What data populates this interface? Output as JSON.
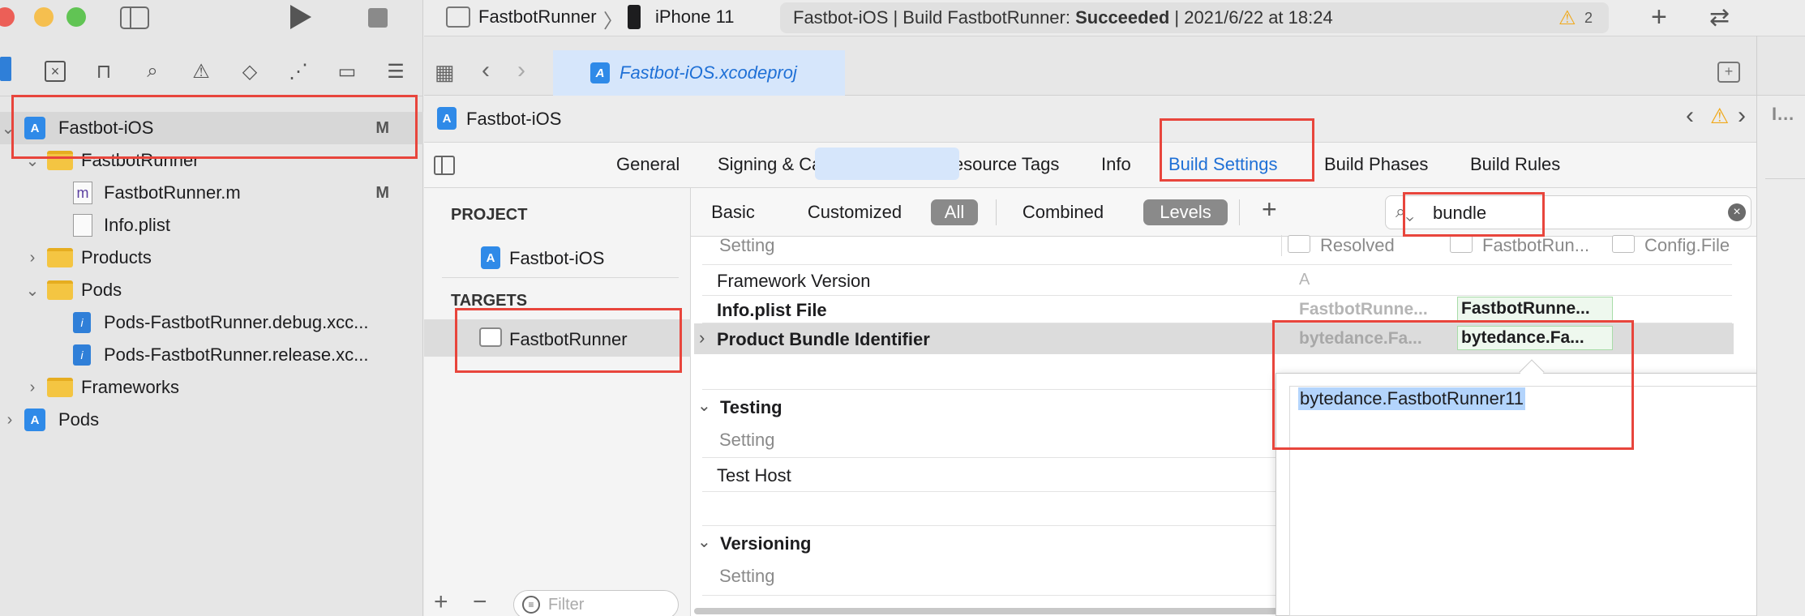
{
  "toolbar": {
    "scheme": "FastbotRunner",
    "device": "iPhone 11",
    "status_prefix": "Fastbot-iOS | Build FastbotRunner: ",
    "status_result": "Succeeded",
    "status_time": " | 2021/6/22 at 18:24",
    "warning_count": "2"
  },
  "active_file_tab": "Fastbot-iOS.xcodeproj",
  "sidebar": {
    "items": [
      {
        "label": "Fastbot-iOS",
        "badge": "M"
      },
      {
        "label": "FastbotRunner"
      },
      {
        "label": "FastbotRunner.m",
        "badge": "M"
      },
      {
        "label": "Info.plist"
      },
      {
        "label": "Products"
      },
      {
        "label": "Pods"
      },
      {
        "label": "Pods-FastbotRunner.debug.xcc..."
      },
      {
        "label": "Pods-FastbotRunner.release.xc..."
      },
      {
        "label": "Frameworks"
      },
      {
        "label": "Pods"
      }
    ]
  },
  "jumpbar": {
    "project": "Fastbot-iOS",
    "inspector_title": "Iden"
  },
  "editor_tabs": [
    "General",
    "Signing & Capabilities",
    "Resource Tags",
    "Info",
    "Build Settings",
    "Build Phases",
    "Build Rules"
  ],
  "targets_panel": {
    "project_header": "PROJECT",
    "project_name": "Fastbot-iOS",
    "targets_header": "TARGETS",
    "target_name": "FastbotRunner",
    "filter_placeholder": "Filter"
  },
  "filter_pills": [
    "Basic",
    "Customized",
    "All",
    "Combined",
    "Levels"
  ],
  "search": {
    "value": "bundle"
  },
  "columns": {
    "setting": "Setting",
    "resolved": "Resolved",
    "target": "FastbotRun...",
    "config": "Config.File"
  },
  "rows": {
    "framework_version": {
      "label": "Framework Version",
      "resolved": "A"
    },
    "info_plist": {
      "label": "Info.plist File",
      "resolved": "FastbotRunne...",
      "target": "FastbotRunne..."
    },
    "bundle_id": {
      "label": "Product Bundle Identifier",
      "resolved": "bytedance.Fa...",
      "target": "bytedance.Fa..."
    }
  },
  "sections": {
    "testing": {
      "title": "Testing",
      "header": "Setting",
      "row": "Test Host"
    },
    "versioning": {
      "title": "Versioning",
      "header": "Setting"
    }
  },
  "popover": {
    "value": "bytedance.FastbotRunner11"
  },
  "colors": {
    "accent": "#1f70d6",
    "annotation": "#e8453c",
    "selection": "#b3d4fc"
  }
}
